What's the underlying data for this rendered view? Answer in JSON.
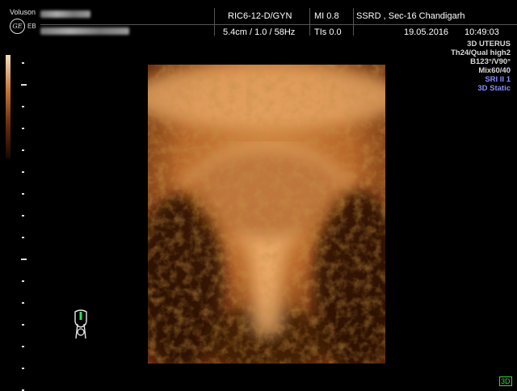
{
  "header": {
    "brand": "Voluson",
    "logo_text": "GE",
    "model_suffix": "EB",
    "probe": "RIC6-12-D/GYN",
    "mi": "MI  0.8",
    "institution": "SSRD , Sec-16 Chandigarh",
    "depth_freq": "5.4cm / 1.0 / 58Hz",
    "tis": "TIs  0.0",
    "date": "19.05.2016",
    "time": "10:49:03"
  },
  "params": {
    "preset": "3D UTERUS",
    "quality": "Th24/Qual high2",
    "angles": "B123°/V90°",
    "mix": "Mix60/40",
    "sri": "SRI II 1",
    "mode": "3D Static"
  },
  "footer": {
    "badge": "3D"
  },
  "icons": {
    "logo": "ge-logo-icon",
    "probe": "probe-orientation-icon",
    "scale": "grayscale-bar-icon"
  },
  "colors": {
    "accent_green": "#40d040",
    "sri_blue": "#8a8aff",
    "tissue": "#b8682a"
  }
}
